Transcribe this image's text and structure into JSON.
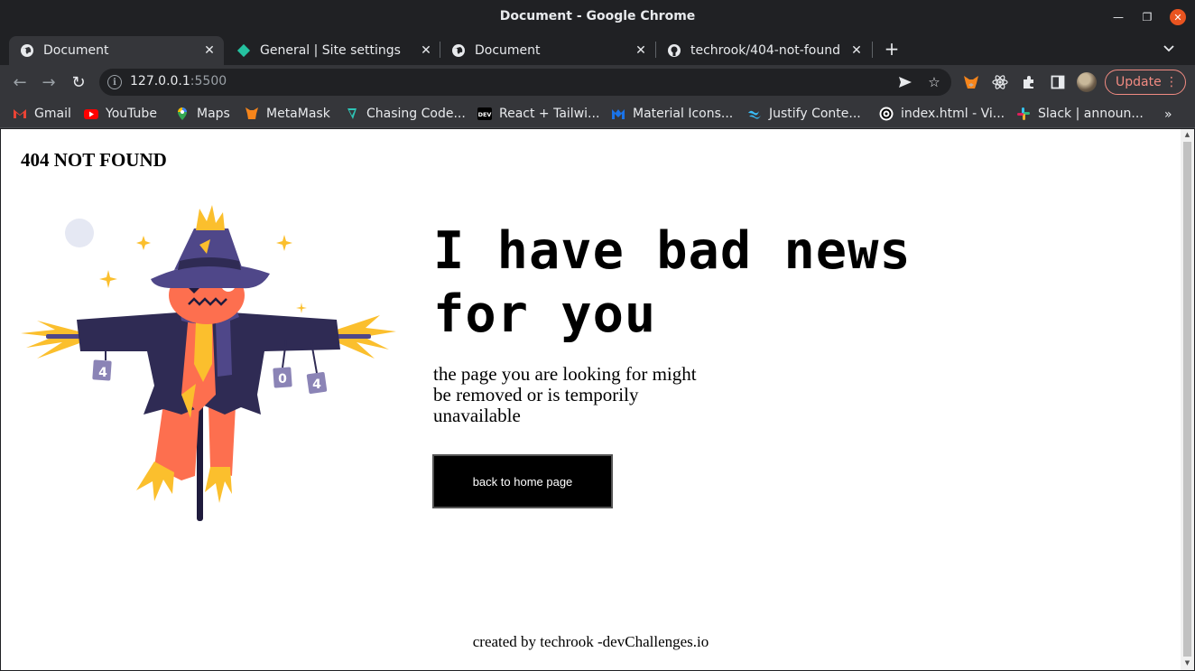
{
  "window": {
    "title": "Document - Google Chrome"
  },
  "tabs": [
    {
      "label": "Document",
      "icon": "globe-icon",
      "active": true
    },
    {
      "label": "General | Site settings",
      "icon": "netlify-icon",
      "active": false
    },
    {
      "label": "Document",
      "icon": "globe-icon",
      "active": false
    },
    {
      "label": "techrook/404-not-found",
      "icon": "github-icon",
      "active": false
    }
  ],
  "toolbar": {
    "url_host": "127.0.0.1",
    "url_port": ":5500",
    "update_label": "Update"
  },
  "bookmarks": [
    {
      "label": "Gmail",
      "icon": "gmail-icon",
      "color": "#ea4335"
    },
    {
      "label": "YouTube",
      "icon": "youtube-icon",
      "color": "#ff0000"
    },
    {
      "label": "Maps",
      "icon": "maps-icon",
      "color": "#34a853"
    },
    {
      "label": "MetaMask",
      "icon": "metamask-icon",
      "color": "#f6851b"
    },
    {
      "label": "Chasing Code...",
      "icon": "chasing-code-icon",
      "color": "#2ec4b6"
    },
    {
      "label": "React + Tailwi...",
      "icon": "dev-icon",
      "color": "#000000"
    },
    {
      "label": "Material Icons...",
      "icon": "material-icon",
      "color": "#1a73e8"
    },
    {
      "label": "Justify Conte...",
      "icon": "tailwind-icon",
      "color": "#38bdf8"
    },
    {
      "label": "index.html - Vi...",
      "icon": "codesandbox-icon",
      "color": "#ffffff"
    },
    {
      "label": "Slack | announ...",
      "icon": "slack-icon",
      "color": "#e01e5a"
    }
  ],
  "page": {
    "brand": "404 NOT FOUND",
    "headline": "I have bad news for you",
    "subtext": "the page you are looking for might be removed or is temporily unavailable",
    "button_label": "back to home page",
    "footer": "created by techrook -devChallenges.io",
    "illustration_digits": [
      "4",
      "0",
      "4"
    ]
  },
  "colors": {
    "chrome_dark": "#202124",
    "chrome_toolbar": "#35363a",
    "update_accent": "#f28b82",
    "close_button": "#e95420",
    "scarecrow_coat": "#2f2b54",
    "scarecrow_hat": "#4f4789",
    "scarecrow_face": "#fd6f4f",
    "straw": "#fbbf2d"
  }
}
